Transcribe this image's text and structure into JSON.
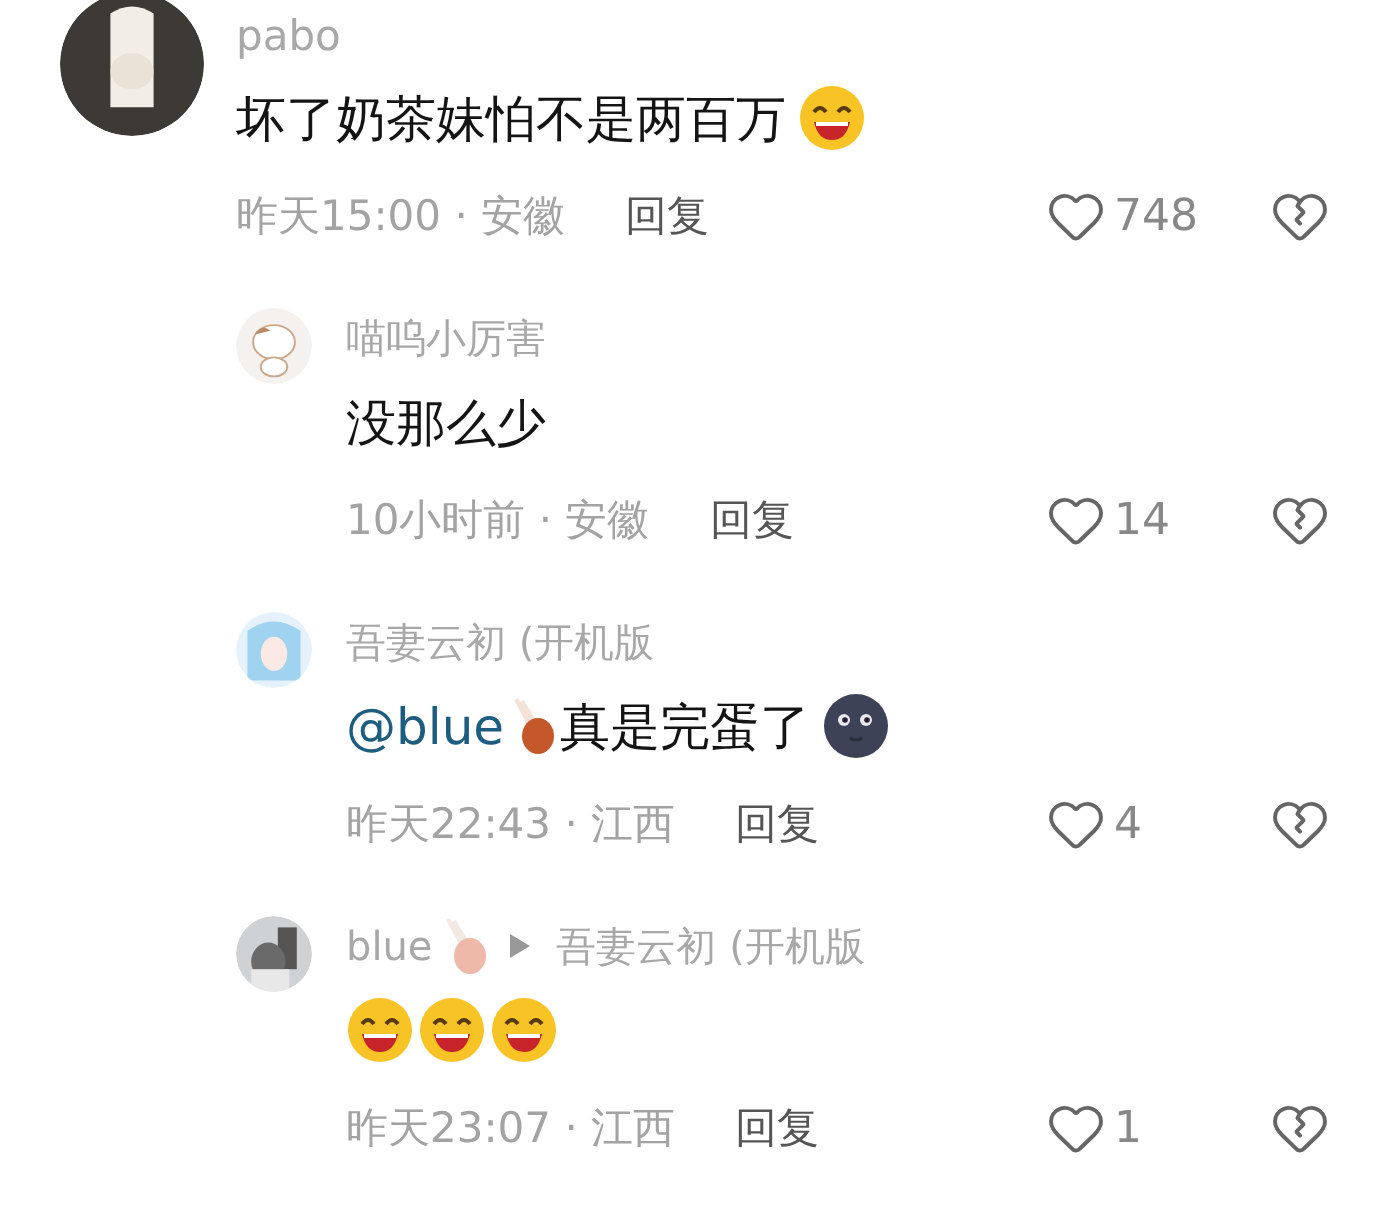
{
  "comment": {
    "avatar": {
      "kind": "picture"
    },
    "name": [
      {
        "kind": "text",
        "text": "pabo"
      }
    ],
    "body": [
      {
        "kind": "text",
        "text": "坏了奶茶妹怕不是两百万"
      },
      {
        "kind": "grin"
      }
    ],
    "meta": "昨天15:00 · 安徽",
    "reply": "回复",
    "likes": "748"
  },
  "replies": [
    {
      "avatar": {
        "kind": "picture"
      },
      "name": [
        {
          "kind": "text",
          "text": "喵呜小厉害"
        }
      ],
      "body": [
        {
          "kind": "text",
          "text": "没那么少"
        }
      ],
      "meta": "10小时前 · 安徽",
      "reply": "回复",
      "likes": "14"
    },
    {
      "avatar": {
        "kind": "picture"
      },
      "name": [
        {
          "kind": "text",
          "text": "吾妻云初 (开机版"
        }
      ],
      "body": [
        {
          "kind": "mention",
          "text": "@blue"
        },
        {
          "kind": "drumstick"
        },
        {
          "kind": "text",
          "text": "真是完蛋了"
        },
        {
          "kind": "moon"
        }
      ],
      "meta": "昨天22:43 · 江西",
      "reply": "回复",
      "likes": "4"
    },
    {
      "avatar": {
        "kind": "picture"
      },
      "name": [
        {
          "kind": "text",
          "text": "blue"
        },
        {
          "kind": "drumstick"
        },
        {
          "kind": "arrow"
        },
        {
          "kind": "text",
          "text": "吾妻云初 (开机版"
        }
      ],
      "body": [
        {
          "kind": "grin"
        },
        {
          "kind": "grin"
        },
        {
          "kind": "grin"
        }
      ],
      "meta": "昨天23:07 · 江西",
      "reply": "回复",
      "likes": "1"
    }
  ]
}
